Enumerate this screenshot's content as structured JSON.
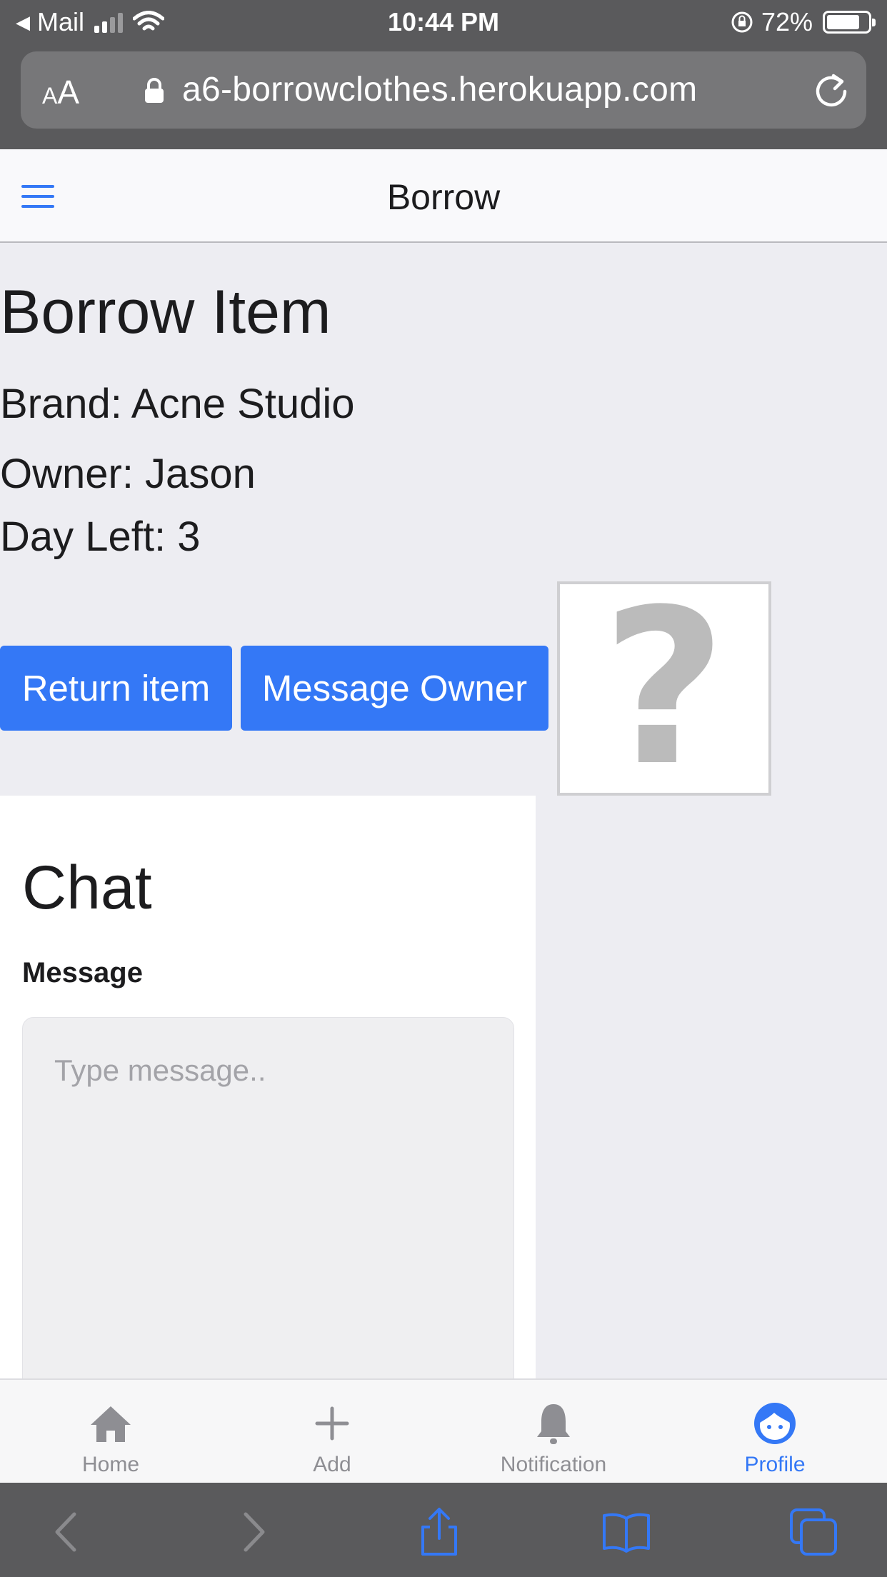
{
  "status_bar": {
    "back_app": "Mail",
    "time": "10:44 PM",
    "battery": "72%"
  },
  "url_bar": {
    "text_size_label": "AA",
    "url": "a6-borrowclothes.herokuapp.com"
  },
  "nav": {
    "title": "Borrow"
  },
  "item": {
    "heading": "Borrow Item",
    "brand": "Brand: Acne Studio",
    "owner": "Owner: Jason",
    "days_left": "Day Left: 3",
    "image_placeholder": "?"
  },
  "actions": {
    "return_label": "Return item",
    "message_label": "Message Owner"
  },
  "chat": {
    "title": "Chat",
    "message_label": "Message",
    "message_placeholder": "Type message.."
  },
  "tabs": [
    {
      "label": "Home",
      "icon": "home-icon"
    },
    {
      "label": "Add",
      "icon": "plus-icon"
    },
    {
      "label": "Notification",
      "icon": "bell-icon"
    },
    {
      "label": "Profile",
      "icon": "profile-face-icon",
      "active": true
    }
  ],
  "colors": {
    "accent": "#3478f6",
    "page_bg": "#ededf2",
    "chrome": "#5a5a5c"
  }
}
